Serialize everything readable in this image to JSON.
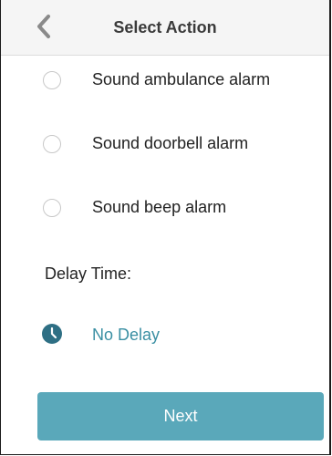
{
  "header": {
    "title": "Select Action",
    "back_icon": "chevron-left-icon"
  },
  "options": [
    {
      "label": "Sound ambulance alarm",
      "selected": false
    },
    {
      "label": "Sound doorbell alarm",
      "selected": false
    },
    {
      "label": "Sound beep alarm",
      "selected": false
    }
  ],
  "delay": {
    "label": "Delay Time:",
    "icon": "clock-icon",
    "value": "No Delay"
  },
  "footer": {
    "next_label": "Next"
  },
  "colors": {
    "accent": "#5aa8ba",
    "link": "#3a8fa3",
    "icon": "#2e6f84",
    "header_bg": "#f5f5f5"
  }
}
